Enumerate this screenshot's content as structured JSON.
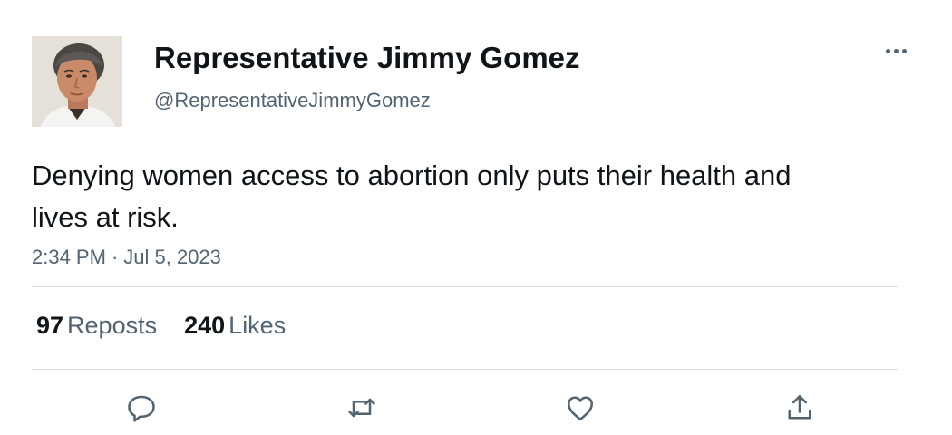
{
  "tweet": {
    "author": {
      "display_name": "Representative Jimmy Gomez",
      "handle": "@RepresentativeJimmyGomez"
    },
    "text": "Denying women access to abortion only puts their health and lives at risk.",
    "time": "2:34 PM",
    "separator": "·",
    "date": "Jul 5, 2023",
    "stats": {
      "reposts": {
        "count": "97",
        "label": "Reposts"
      },
      "likes": {
        "count": "240",
        "label": "Likes"
      }
    }
  },
  "icons": {
    "more": "more-horizontal-icon",
    "reply": "reply-icon",
    "repost": "repost-icon",
    "like": "heart-icon",
    "share": "share-icon"
  },
  "colors": {
    "text_primary": "#0f1419",
    "text_secondary": "#536471",
    "divider": "#d6dbdf",
    "icon": "#536471"
  }
}
